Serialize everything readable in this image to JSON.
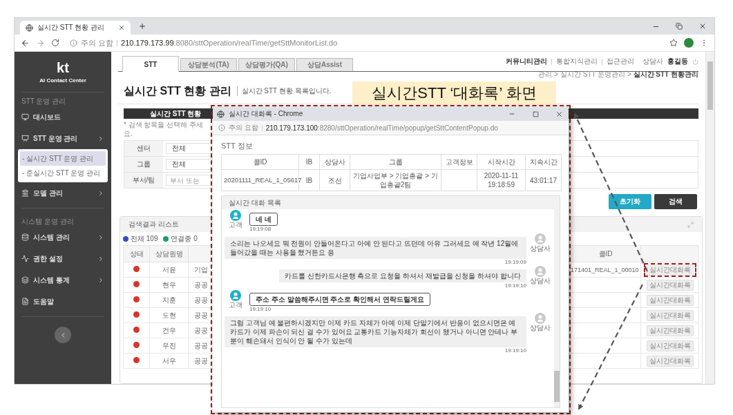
{
  "browser": {
    "tab_title": "실시간 STT 현황 관리",
    "address": {
      "warning": "주의 요함",
      "host": "210.179.173.99",
      "path": ":8080/sttOperation/realTime/getSttMonitorList.do"
    }
  },
  "sidebar": {
    "logo": "kt",
    "subtitle": "AI Contact Center",
    "sections": [
      {
        "label": "STT 운영 관리",
        "items": [
          {
            "label": "대시보드",
            "kind": "link"
          },
          {
            "label": "STT 운영 관리",
            "kind": "menu",
            "children": [
              {
                "label": "- 실시간 STT 운영 관리",
                "selected": true
              },
              {
                "label": "- 준실시간 STT 운영 관리",
                "selected": false
              }
            ]
          },
          {
            "label": "모델 관리",
            "kind": "menu"
          }
        ]
      },
      {
        "label": "시스템 운영 관리",
        "items": [
          {
            "label": "시스템 관리",
            "kind": "menu"
          },
          {
            "label": "권한 설정",
            "kind": "menu"
          },
          {
            "label": "시스템 통계",
            "kind": "menu"
          },
          {
            "label": "도움말",
            "kind": "link"
          }
        ]
      }
    ]
  },
  "top_tabs": [
    {
      "label": "STT",
      "selected": true
    },
    {
      "label": "상담분석(TA)",
      "selected": false
    },
    {
      "label": "상담평가(QA)",
      "selected": false
    },
    {
      "label": "상담Assist",
      "selected": false
    }
  ],
  "top_links": [
    "커뮤니티관리",
    "통합지식관리",
    "접근관리"
  ],
  "user": {
    "role": "상담사",
    "name": "홍길동"
  },
  "page": {
    "title": "실시간 STT 현황 관리",
    "subtitle": "실시간 STT 현황 목록입니다.",
    "breadcrumb": "관리 > 실시간 STT 운영관리 > **실시간 STT 현황관리**"
  },
  "search": {
    "header": "실시간 STT 현황",
    "note": "* 검색 항목을 선택해 주세요.",
    "fields": [
      {
        "label": "센터",
        "value": "전체"
      },
      {
        "label": "그룹",
        "value": "전체"
      },
      {
        "label": "부서/팀",
        "placeholder": "부서 또는"
      }
    ],
    "buttons": [
      {
        "label": "초기화",
        "kind": "reset"
      },
      {
        "label": "검색",
        "kind": "search"
      }
    ]
  },
  "results": {
    "title": "검색결과 리스트",
    "legend": [
      {
        "label": "전체 109",
        "color": "#2f4fc8"
      },
      {
        "label": "연결중 0",
        "color": "#1a9e6a"
      }
    ],
    "columns": [
      "상태",
      "상담원명",
      "콜ID"
    ],
    "rows": [
      {
        "color": "#d9342b",
        "agent": "서윤",
        "column_3": "기업",
        "call_id": "171401_REAL_1_00010",
        "action": "실시간대화록",
        "highlighted": true
      },
      {
        "color": "#d9342b",
        "agent": "현우",
        "column_3": "공공",
        "action": "실시간대화록",
        "highlighted": false
      },
      {
        "color": "#d9342b",
        "agent": "지훈",
        "column_3": "공공",
        "action": "실시간대화록",
        "highlighted": false
      },
      {
        "color": "#d9342b",
        "agent": "도현",
        "column_3": "공공",
        "action": "실시간대화록",
        "highlighted": false
      },
      {
        "color": "#d9342b",
        "agent": "건우",
        "column_3": "공공",
        "action": "실시간대화록",
        "highlighted": false
      },
      {
        "color": "#d9342b",
        "agent": "우진",
        "column_3": "공공",
        "action": "실시간대화록",
        "highlighted": false
      },
      {
        "color": "#d9342b",
        "agent": "서우",
        "column_3": "공공",
        "action": "실시간대화록",
        "highlighted": false
      }
    ]
  },
  "callout": {
    "text": "실시간STT ‘대화록’ 화면"
  },
  "popup": {
    "title": "실시간 대화록 - Chrome",
    "address": {
      "warning": "주의 요함",
      "host": "210.179.173.100",
      "path": ":8280/sttOperation/realTime/popup/getSttContentPopup.do"
    },
    "info_title": "STT 정보",
    "info_columns": [
      "콜ID",
      "IB",
      "상담사",
      "그룹",
      "고객정보",
      "시작시간",
      "지속시간"
    ],
    "info_row": {
      "call_id": "20201111_REAL_1_05617",
      "ib": "IB",
      "agent": "조선",
      "group": "기업사업부 > 기업총괄 > 기업총괄2팀",
      "start_time": "2020-11-11 19:18:59",
      "duration": "43:01:17"
    },
    "chat_title": "실시간 대화 목록",
    "messages": [
      {
        "kind": "customer",
        "speaker": "고객",
        "text": "네 네",
        "time": "19:19:08"
      },
      {
        "kind": "agent",
        "speaker": "상담사",
        "text": "소리는 나오세요 뭐 전원이 안들어온다고 아예 안 된다고 뜨던데 아유 그러세요 예 작년 12월에 들어갔을 때는 사용을 했거든요 응",
        "time": "19:19:09"
      },
      {
        "kind": "agent",
        "speaker": "상담사",
        "text": "카드를 신한카드사은행 측으로 요청을 하셔서 재발급을 신청을 하셔야 합니다",
        "time": "19:19:10"
      },
      {
        "kind": "customer",
        "speaker": "고객",
        "text": "주소 주소 말씀해주시면 주소로 확인해서 연락드릴게요",
        "time": "19:19:10"
      },
      {
        "kind": "agent",
        "speaker": "상담사",
        "text": "그럼 고객님 예 불편하시겠지만 이제 카드 자체가 아예 이제 단말기에서 반응이 없으시면은 예 카드가 이제 파손이 되신 걸 수가 있어요 교통카드 기능자체가 회선이 됐거나 아니면 안테나 부분이 훼손돼서 인식이 안 될 수가 있는데",
        "time": "19:19:10"
      }
    ]
  }
}
